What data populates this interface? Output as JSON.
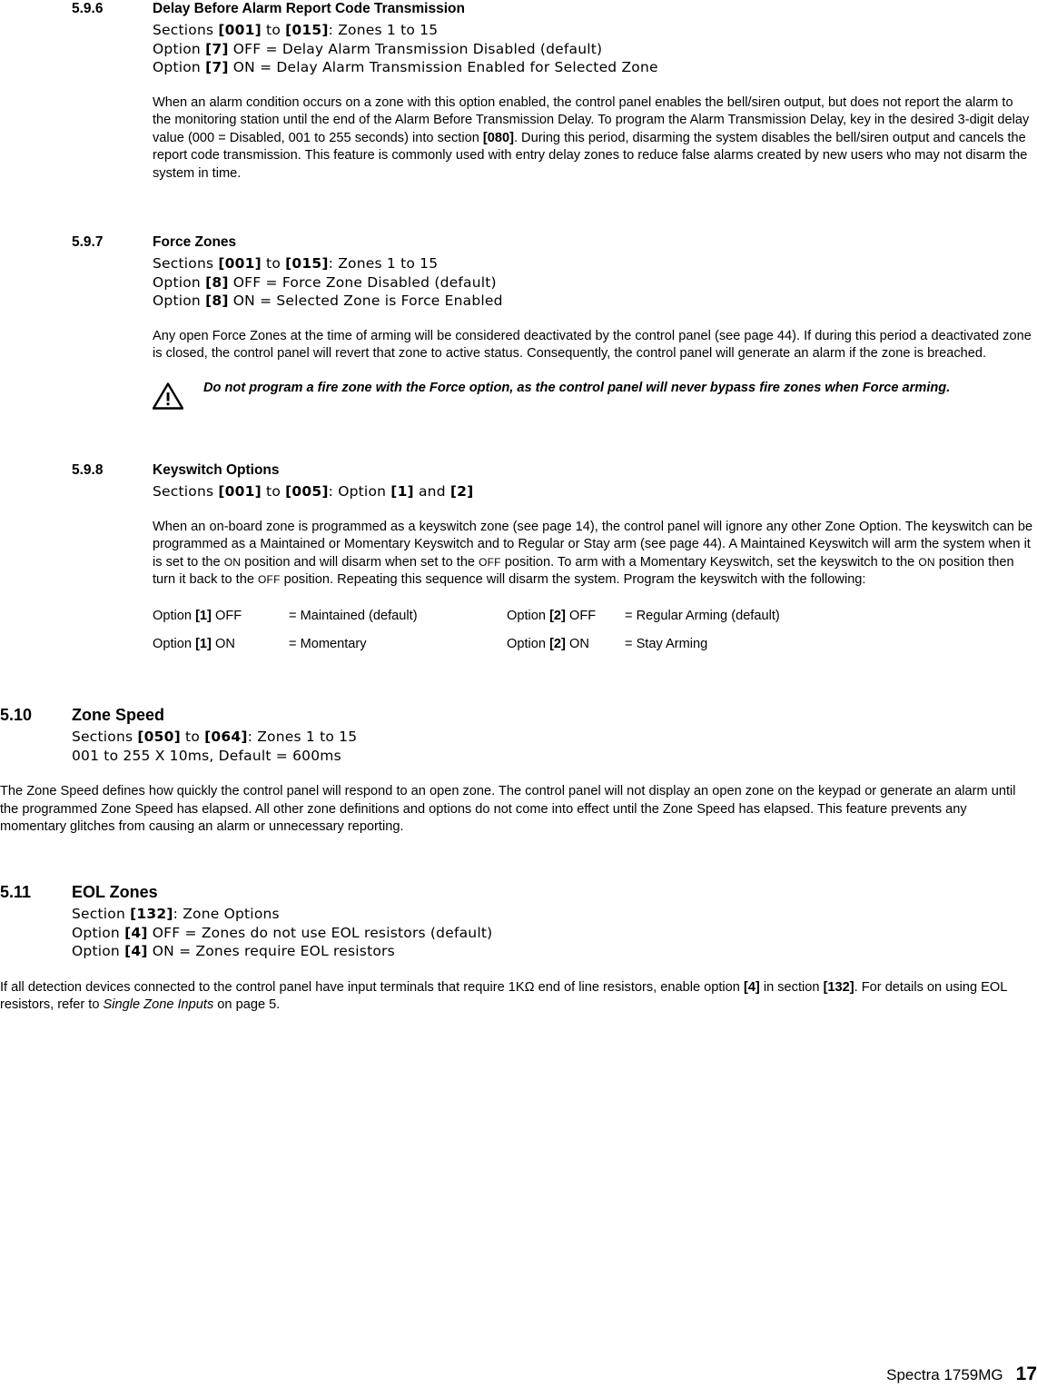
{
  "sections": {
    "s596": {
      "number": "5.9.6",
      "title": "Delay Before Alarm Report Code Transmission",
      "line1": "Sections [001] to [015]: Zones 1 to 15",
      "line2": "Option [7] OFF   = Delay Alarm Transmission Disabled (default)",
      "line3": "Option [7] ON    = Delay Alarm Transmission Enabled for Selected Zone",
      "para": "When an alarm condition occurs on a zone with this option enabled, the control panel enables the bell/siren output, but does not report the alarm to the monitoring station until the end of the Alarm Before Transmission Delay. To program the Alarm Transmission Delay, key in the desired 3-digit delay value (000 = Disabled, 001 to 255 seconds) into section [080]. During this period, disarming the system disables the bell/siren output and cancels the report code transmission. This feature is commonly used with entry delay zones to reduce false alarms created by new users who may not disarm the system in time."
    },
    "s597": {
      "number": "5.9.7",
      "title": "Force Zones",
      "line1": "Sections [001] to [015]: Zones 1 to 15",
      "line2": "Option [8] OFF   = Force Zone Disabled (default)",
      "line3": "Option [8] ON    = Selected Zone is Force Enabled",
      "para": "Any open Force Zones at the time of arming will be considered deactivated by the control panel (see page 44). If during this period a deactivated zone is closed, the control panel will revert that zone to active status. Consequently, the control panel will generate an alarm if the zone is breached.",
      "warning": "Do not program a fire zone with the Force option, as the control panel will never bypass fire zones when Force arming."
    },
    "s598": {
      "number": "5.9.8",
      "title": "Keyswitch Options",
      "line1": "Sections [001] to [005]: Option [1] and [2]",
      "para_1": "When an on-board zone is programmed as a keyswitch zone (see page 14), the control panel will ignore any other Zone Option. The keyswitch can be programmed as a Maintained or Momentary Keyswitch and to Regular or Stay arm (see page 44). A Maintained Keyswitch will arm the system when it is set to the ",
      "para_on_1": "ON",
      "para_2": " position and will disarm when set to the ",
      "para_off_1": "OFF",
      "para_3": " position. To arm with a Momentary Keyswitch, set the keyswitch to the ",
      "para_on_2": "ON",
      "para_4": " position then turn it back to the ",
      "para_off_2": "OFF",
      "para_5": " position. Repeating this sequence will disarm the system. Program the keyswitch with the following:",
      "options": [
        {
          "left_label": "Option",
          "left_bold": "[1]",
          "left_state": "OFF",
          "left_value": "= Maintained (default)",
          "right_label": "Option",
          "right_bold": "[2]",
          "right_state": "OFF",
          "right_value": "= Regular Arming (default)"
        },
        {
          "left_label": "Option",
          "left_bold": "[1]",
          "left_state": "ON",
          "left_value": "= Momentary",
          "right_label": "Option",
          "right_bold": "[2]",
          "right_state": "ON",
          "right_value": "= Stay Arming"
        }
      ]
    },
    "s510": {
      "number": "5.10",
      "title": "Zone Speed",
      "line1": "Sections [050] to [064]: Zones 1 to 15",
      "line2": "001 to 255 X 10ms, Default = 600ms",
      "para": "The Zone Speed defines how quickly the control panel will respond to an open zone. The control panel will not display an open zone on the keypad or generate an alarm until the programmed Zone Speed has elapsed. All other zone definitions and options do not come into effect until the Zone Speed has elapsed. This feature prevents any momentary glitches from causing an alarm or unnecessary reporting."
    },
    "s511": {
      "number": "5.11",
      "title": "EOL Zones",
      "line1": "Section [132]: Zone Options",
      "line2": "Option [4] OFF  = Zones do not use EOL resistors (default)",
      "line3": "Option [4] ON   = Zones require EOL resistors",
      "para_1": "If all detection devices connected to the control panel have input terminals that require 1K",
      "para_omega": "Ω",
      "para_2": " end of line resistors, enable option ",
      "para_b1": "[4]",
      "para_3": " in section ",
      "para_b2": "[132]",
      "para_4": ". For details on using EOL resistors, refer to ",
      "para_i": "Single Zone Inputs",
      "para_5": " on page 5."
    }
  },
  "footer": {
    "title": "Spectra 1759MG",
    "page": "17"
  }
}
